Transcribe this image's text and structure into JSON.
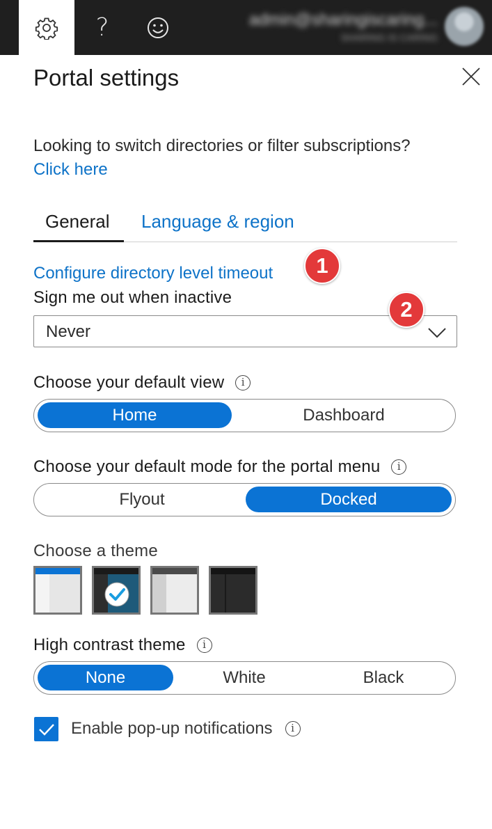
{
  "topbar": {
    "buttons": [
      {
        "icon": "gear-icon",
        "active": true
      },
      {
        "icon": "help-icon",
        "label": "?"
      },
      {
        "icon": "smiley-icon"
      }
    ],
    "account_email": "admin@sharingiscaring...",
    "account_org": "SHARING IS CARING"
  },
  "panel": {
    "title": "Portal settings",
    "switch_text": "Looking to switch directories or filter subscriptions?",
    "click_here": "Click here",
    "tabs": [
      "General",
      "Language & region"
    ],
    "configure_link": "Configure directory level timeout",
    "badges": [
      "1",
      "2"
    ],
    "signout": {
      "label": "Sign me out when inactive",
      "value": "Never"
    },
    "default_view": {
      "label": "Choose your default view",
      "options": [
        "Home",
        "Dashboard"
      ],
      "selected": "Home"
    },
    "menu_mode": {
      "label": "Choose your default mode for the portal menu",
      "options": [
        "Flyout",
        "Docked"
      ],
      "selected": "Docked"
    },
    "theme": {
      "label": "Choose a theme",
      "selected_index": 1
    },
    "high_contrast": {
      "label": "High contrast theme",
      "options": [
        "None",
        "White",
        "Black"
      ],
      "selected": "None"
    },
    "popup": {
      "label": "Enable pop-up notifications",
      "checked": true
    },
    "info_symbol": "i"
  },
  "colors": {
    "accent": "#0b73d4",
    "link": "#0e73c8",
    "badge": "#e3393a",
    "topbar": "#1f1f1f"
  }
}
